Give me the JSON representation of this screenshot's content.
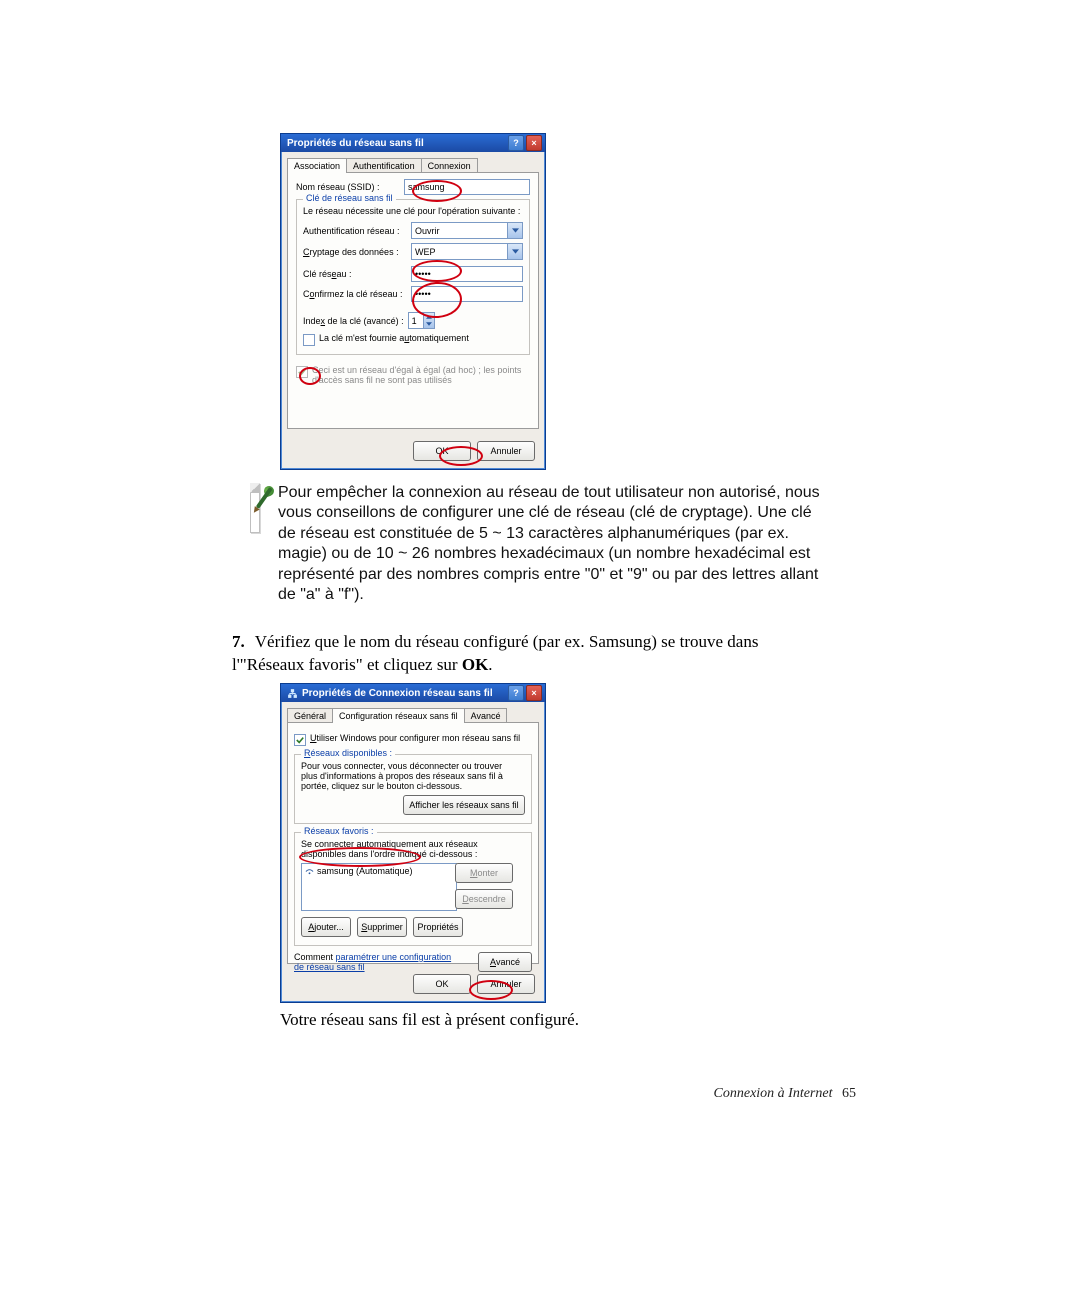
{
  "dlg1": {
    "title": "Propriétés du réseau sans fil",
    "tabs": [
      "Association",
      "Authentification",
      "Connexion"
    ],
    "ssid_label": "Nom réseau (SSID) :",
    "ssid_value": "samsung",
    "group_title": "Clé de réseau sans fil",
    "group_intro": "Le réseau nécessite une clé pour l'opération suivante :",
    "auth_label": "Authentification réseau :",
    "auth_value": "Ouvrir",
    "enc_label": "Cryptage des données :",
    "enc_value": "WEP",
    "key_label": "Clé réseau :",
    "key_value": "•••••",
    "key2_label": "Confirmez la clé réseau :",
    "key2_value": "•••••",
    "index_label": "Index de la clé (avancé) :",
    "index_value": "1",
    "auto_key_label": "La clé m'est fournie automatiquement",
    "adhoc_label": "Ceci est un réseau d'égal à égal (ad hoc) ; les points d'accès sans fil ne sont pas utilisés",
    "ok": "OK",
    "cancel": "Annuler"
  },
  "note": "Pour empêcher la connexion au réseau de tout utilisateur non autorisé, nous vous conseillons de configurer une clé de réseau (clé de cryptage). Une clé de réseau est constituée de 5 ~ 13 caractères alphanumériques (par ex. magie) ou de 10 ~ 26 nombres hexadécimaux (un nombre hexadécimal est représenté par des nombres compris entre \"0\" et \"9\" ou par des lettres allant de \"a\" à \"f\").",
  "step7": {
    "num": "7.",
    "text_a": "Vérifiez que le nom du réseau configuré (par ex. Samsung) se trouve dans l'\"Réseaux favoris\"  et cliquez sur ",
    "text_b": "OK",
    "text_c": "."
  },
  "dlg2": {
    "title": "Propriétés de Connexion réseau sans fil",
    "tabs": [
      "Général",
      "Configuration réseaux sans fil",
      "Avancé"
    ],
    "use_windows": "Utiliser Windows pour configurer mon réseau sans fil",
    "avail_title": "Réseaux disponibles :",
    "avail_text": "Pour vous connecter, vous déconnecter ou trouver plus d'informations à propos des réseaux sans fil à portée, cliquez sur le bouton ci-dessous.",
    "avail_btn": "Afficher les réseaux sans fil",
    "fav_title": "Réseaux favoris :",
    "fav_text": "Se connecter automatiquement aux réseaux disponibles dans l'ordre indiqué ci-dessous :",
    "fav_item": "samsung (Automatique)",
    "up": "Monter",
    "down": "Descendre",
    "add": "Ajouter...",
    "remove": "Supprimer",
    "props": "Propriétés",
    "howto_a": "Comment ",
    "howto_b": "paramétrer une configuration de réseau sans fil",
    "adv": "Avancé",
    "ok": "OK",
    "cancel": "Annuler"
  },
  "after": "Votre réseau sans fil est à présent configuré.",
  "footer": {
    "label": "Connexion à Internet",
    "page": "65"
  }
}
